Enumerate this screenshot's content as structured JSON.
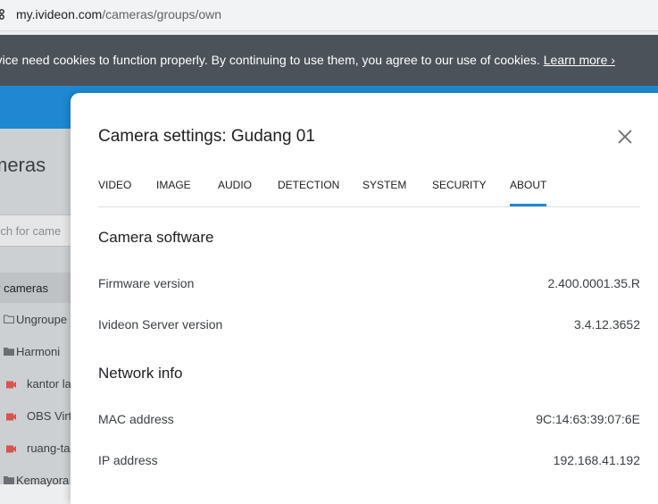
{
  "browser": {
    "url_host": "my.ivideon.com",
    "url_path": "/cameras/groups/own"
  },
  "cookie_banner": {
    "text": "rvice need cookies to function properly. By continuing to use them, you agree to our use of cookies.",
    "link": "Learn more ›"
  },
  "background": {
    "page_title": "meras",
    "search_placeholder": "rch for came",
    "my_cameras": "y cameras",
    "items": [
      {
        "label": "Ungroupe",
        "icon": "folder-outline-icon"
      },
      {
        "label": "Harmoni",
        "icon": "folder-icon"
      },
      {
        "label": "kantor la",
        "icon": "camera-icon"
      },
      {
        "label": "OBS Virt",
        "icon": "camera-icon"
      },
      {
        "label": "ruang-ta",
        "icon": "camera-icon"
      },
      {
        "label": "Kemayora",
        "icon": "folder-icon"
      }
    ],
    "colors": {
      "header": "#1e88d2",
      "camera_icon": "#d9534f"
    }
  },
  "modal": {
    "title": "Camera settings: Gudang 01",
    "tabs": [
      "VIDEO",
      "IMAGE",
      "AUDIO",
      "DETECTION",
      "SYSTEM",
      "SECURITY",
      "ABOUT"
    ],
    "active_tab": "ABOUT",
    "sections": {
      "software": {
        "heading": "Camera software",
        "rows": [
          {
            "label": "Firmware version",
            "value": "2.400.0001.35.R"
          },
          {
            "label": "Ivideon Server version",
            "value": "3.4.12.3652"
          }
        ]
      },
      "network": {
        "heading": "Network info",
        "rows": [
          {
            "label": "MAC address",
            "value": "9C:14:63:39:07:6E"
          },
          {
            "label": "IP address",
            "value": "192.168.41.192"
          }
        ]
      }
    }
  }
}
